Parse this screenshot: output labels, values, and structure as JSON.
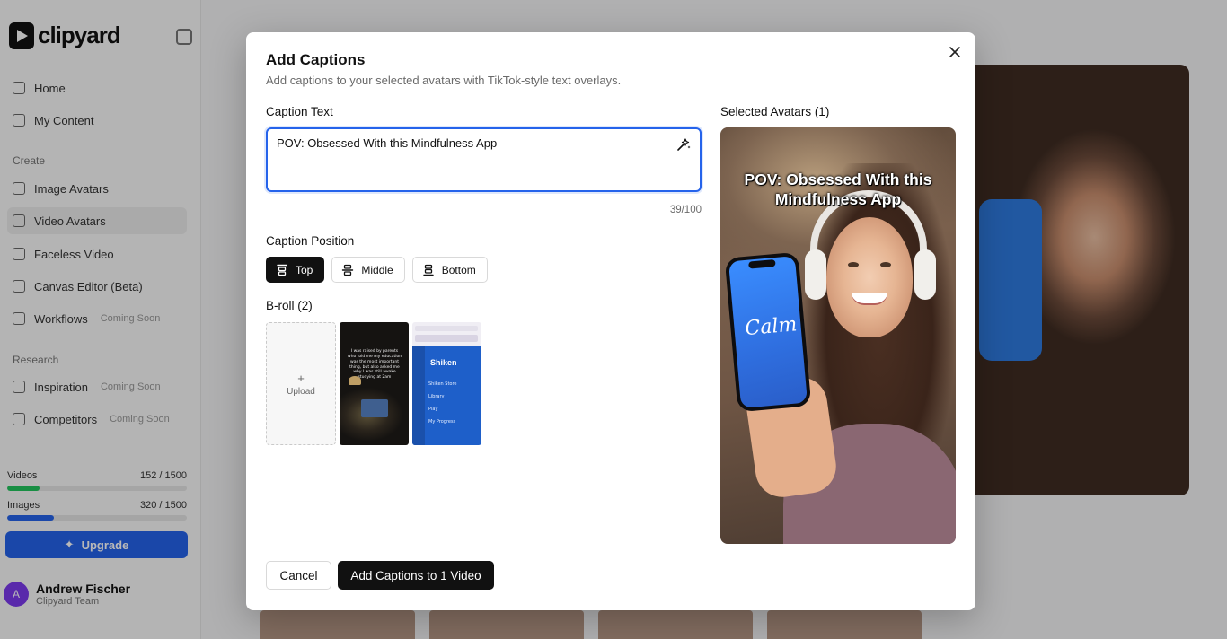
{
  "background": {
    "brand": "clipyard",
    "nav": [
      {
        "label": "Home"
      },
      {
        "label": "My Content"
      }
    ],
    "create_label": "Create",
    "create_items": [
      {
        "label": "Image Avatars",
        "tag": ""
      },
      {
        "label": "Video Avatars",
        "tag": ""
      },
      {
        "label": "Faceless Video",
        "tag": ""
      },
      {
        "label": "Canvas Editor (Beta)",
        "tag": ""
      },
      {
        "label": "Workflows",
        "tag": "Coming Soon"
      }
    ],
    "research_label": "Research",
    "research_items": [
      {
        "label": "Inspiration",
        "tag": "Coming Soon"
      },
      {
        "label": "Competitors",
        "tag": "Coming Soon"
      }
    ],
    "usage": [
      {
        "label": "Videos",
        "value": "152 / 1500",
        "fraction": 0.18,
        "color": "#22c55e"
      },
      {
        "label": "Images",
        "value": "320 / 1500",
        "fraction": 0.26,
        "color": "#2563eb"
      }
    ],
    "upgrade_label": "Upgrade",
    "user": {
      "initial": "A",
      "name": "Andrew Fischer",
      "sub": "Clipyard Team"
    }
  },
  "modal": {
    "title": "Add Captions",
    "description": "Add captions to your selected avatars with TikTok-style text overlays.",
    "caption_text_label": "Caption Text",
    "caption_value": "POV: Obsessed With this Mindfulness App",
    "char_count": "39/100",
    "position_label": "Caption Position",
    "positions": [
      {
        "label": "Top",
        "selected": true
      },
      {
        "label": "Middle",
        "selected": false
      },
      {
        "label": "Bottom",
        "selected": false
      }
    ],
    "broll_label": "B-roll (2)",
    "upload_label": "Upload",
    "broll_items": [
      {
        "caption": "I was raised by parents who told me my education was the most important thing, but also asked me why I was still awake studying at 2am"
      },
      {
        "brand": "Shiken",
        "menu": [
          "Shiken Store",
          "Library",
          "Play",
          "My Progress"
        ]
      }
    ],
    "selected_label": "Selected Avatars (1)",
    "preview_caption": "POV: Obsessed With this Mindfulness App",
    "preview_phone_logo": "Calm",
    "cancel_label": "Cancel",
    "submit_label": "Add Captions to 1 Video"
  }
}
